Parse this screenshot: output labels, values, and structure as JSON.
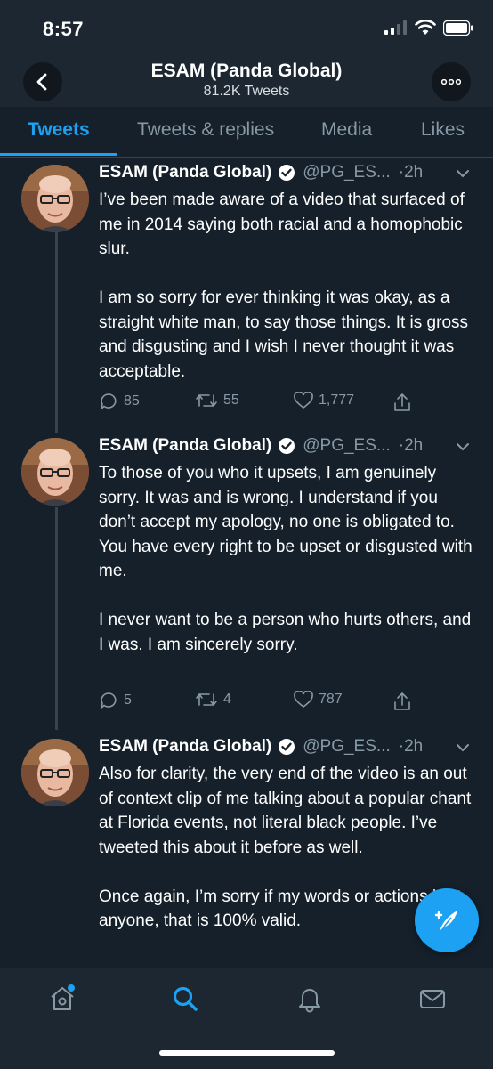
{
  "status_bar": {
    "time": "8:57"
  },
  "header": {
    "title": "ESAM (Panda Global)",
    "subtitle": "81.2K Tweets"
  },
  "tabs": [
    {
      "label": "Tweets",
      "active": true
    },
    {
      "label": "Tweets & replies",
      "active": false
    },
    {
      "label": "Media",
      "active": false
    },
    {
      "label": "Likes",
      "active": false
    }
  ],
  "tweets": [
    {
      "name": "ESAM (Panda Global)",
      "handle": "@PG_ES...",
      "time": "·2h",
      "text": "I’ve been made aware of a video that surfaced of me in 2014 saying both racial and a homophobic slur.\n\nI am so sorry for ever thinking it was okay, as a straight white man, to say those things. It is gross and disgusting and I wish I never thought it was acceptable.",
      "replies": "85",
      "retweets": "55",
      "likes": "1,777"
    },
    {
      "name": "ESAM (Panda Global)",
      "handle": "@PG_ES...",
      "time": "·2h",
      "text": "To those of you who it upsets, I am genuinely sorry. It was and is wrong. I understand if you don’t accept my apology, no one is obligated to. You have every right to be upset or disgusted with me.\n\nI never want to be a person who hurts others, and I was. I am sincerely sorry.",
      "replies": "5",
      "retweets": "4",
      "likes": "787"
    },
    {
      "name": "ESAM (Panda Global)",
      "handle": "@PG_ES...",
      "time": "·2h",
      "text": "Also for clarity, the very end of the video is an out of context clip of me talking about a popular chant at Florida events, not literal black people. I’ve tweeted this about it before as well.\n\nOnce again, I’m sorry if my words or actions hurt anyone, that is 100% valid.",
      "replies": "",
      "retweets": "",
      "likes": ""
    }
  ],
  "icons": {
    "back": "chevron-left-icon",
    "more": "more-icon",
    "verified": "verified-badge-icon",
    "reply": "reply-icon",
    "retweet": "retweet-icon",
    "like": "heart-icon",
    "share": "share-icon",
    "compose": "compose-tweet-icon",
    "nav": [
      "home-icon",
      "search-icon",
      "notifications-icon",
      "messages-icon"
    ]
  },
  "colors": {
    "background": "#15202b",
    "accent": "#1da1f2",
    "secondary_text": "#8899a6"
  }
}
